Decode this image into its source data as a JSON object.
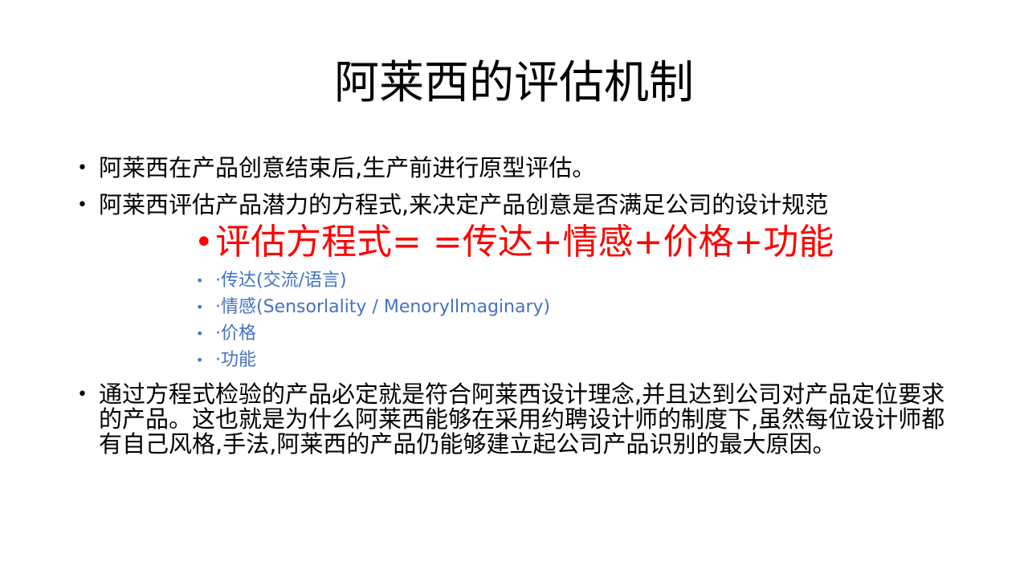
{
  "slide": {
    "title": "阿莱西的评估机制",
    "bullets": [
      {
        "marker": "•",
        "text": "阿莱西在产品创意结束后,生产前进行原型评估。"
      },
      {
        "marker": "•",
        "text": "阿莱西评估产品潜力的方程式,来决定产品创意是否满足公司的设计规范"
      }
    ],
    "equation": {
      "marker": "•",
      "text": "评估方程式= =传达+情感+价格+功能"
    },
    "sub_items": [
      {
        "marker": "•",
        "text": "·传达(交流/语言)"
      },
      {
        "marker": "•",
        "text": "·情感(Sensorlality / Menoryllmaginary)"
      },
      {
        "marker": "•",
        "text": "·价格"
      },
      {
        "marker": "•",
        "text": "·功能"
      }
    ],
    "conclusion": {
      "marker": "•",
      "text": "通过方程式检验的产品必定就是符合阿莱西设计理念,并且达到公司对产品定位要求的产品。这也就是为什么阿莱西能够在采用约聘设计师的制度下,虽然每位设计师都有自己风格,手法,阿莱西的产品仍能够建立起公司产品识别的最大原因。"
    },
    "colors": {
      "background": "#ffffff",
      "text": "#000000",
      "equation": "#ff0000",
      "sub_items": "#4472c4"
    }
  }
}
